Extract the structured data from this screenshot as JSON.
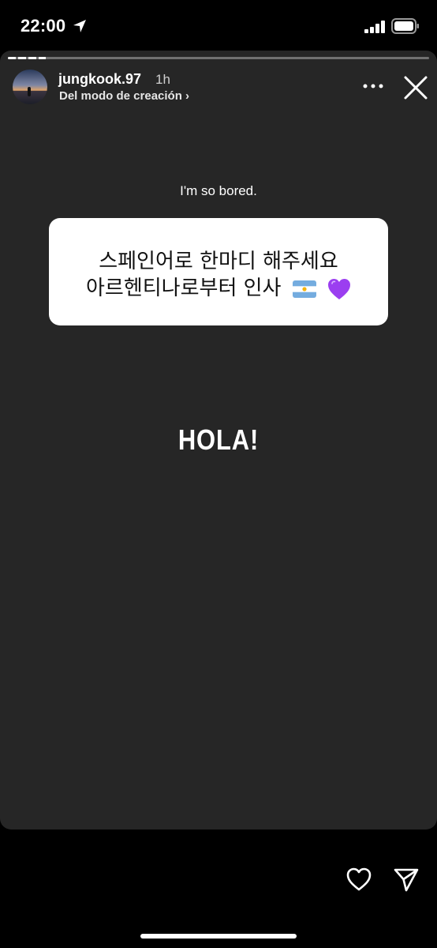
{
  "status_bar": {
    "time": "22:00"
  },
  "story": {
    "progress": 0.09,
    "username": "jungkook.97",
    "time_ago": "1h",
    "subtitle": "Del modo de creación",
    "caption": "I'm so bored.",
    "question_line1": "스페인어로 한마디 해주세요",
    "question_line2": "아르헨티나로부터 인사",
    "answer": "HOLA!"
  },
  "colors": {
    "background": "#000000",
    "story_background": "#262626",
    "question_box": "#ffffff",
    "heart_purple": "#9b3ef0",
    "flag_blue": "#74acdf"
  },
  "icons": {
    "location": "location-arrow-icon",
    "signal": "cellular-signal-icon",
    "battery": "battery-icon",
    "more": "more-horizontal-icon",
    "close": "close-icon",
    "flag": "argentina-flag-emoji",
    "purple_heart": "purple-heart-emoji",
    "like": "heart-outline-icon",
    "send": "send-icon"
  }
}
